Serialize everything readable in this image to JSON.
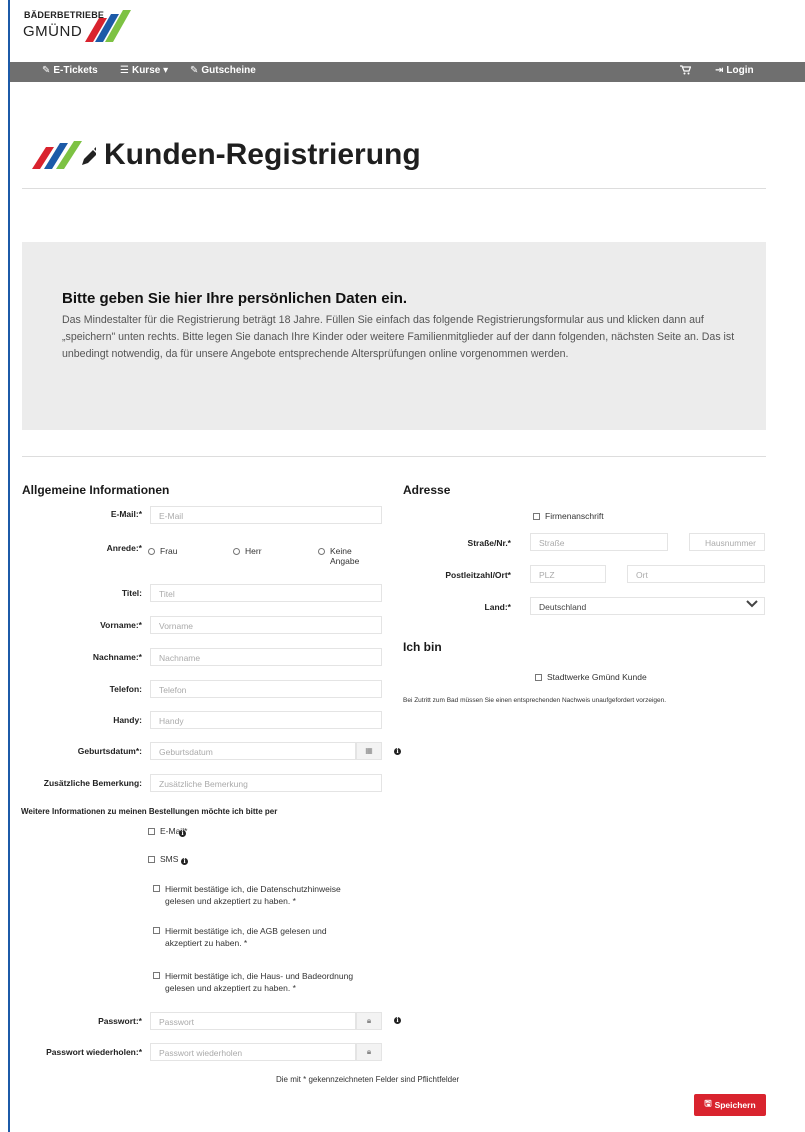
{
  "brand": {
    "line1": "BÄDERBETRIEBE",
    "line2": "GMÜND"
  },
  "colors": {
    "navbar": "#6f6f6f",
    "accent_red": "#d9232e",
    "brand_blue": "#1c5aa8",
    "brand_green": "#7dc243"
  },
  "nav": {
    "left": [
      {
        "icon": "ticket-icon",
        "label": "E-Tickets"
      },
      {
        "icon": "list-icon",
        "label": "Kurse ▾"
      },
      {
        "icon": "ticket-icon",
        "label": "Gutscheine"
      }
    ],
    "cart_icon": "cart-icon",
    "login": {
      "icon": "login-icon",
      "label": "Login"
    }
  },
  "page": {
    "title": "Kunden-Registrierung",
    "title_icon": "pencil-icon"
  },
  "intro": {
    "heading": "Bitte geben Sie hier Ihre persönlichen Daten ein.",
    "text": "Das Mindestalter für die Registrierung beträgt 18 Jahre. Füllen Sie einfach das folgende Registrierungsformular aus und klicken dann auf „speichern\" unten rechts. Bitte legen Sie danach Ihre Kinder oder weitere Familienmitglieder auf der dann folgenden, nächsten Seite an. Das ist unbedingt notwendig, da für unsere Angebote entsprechende Altersprüfungen online vorgenommen werden."
  },
  "general": {
    "heading": "Allgemeine Informationen",
    "email": {
      "label": "E-Mail:*",
      "placeholder": "E-Mail"
    },
    "salutation": {
      "label": "Anrede:*",
      "options": [
        "Frau",
        "Herr",
        "Keine Angabe"
      ]
    },
    "title": {
      "label": "Titel:",
      "placeholder": "Titel"
    },
    "firstname": {
      "label": "Vorname:*",
      "placeholder": "Vorname"
    },
    "lastname": {
      "label": "Nachname:*",
      "placeholder": "Nachname"
    },
    "phone": {
      "label": "Telefon:",
      "placeholder": "Telefon"
    },
    "mobile": {
      "label": "Handy:",
      "placeholder": "Handy"
    },
    "birthdate": {
      "label": "Geburtsdatum*:",
      "placeholder": "Geburtsdatum"
    },
    "remark": {
      "label": "Zusätzliche Bemerkung:",
      "placeholder": "Zusätzliche Bemerkung"
    },
    "contact_pref": "Weitere Informationen zu meinen Bestellungen möchte ich bitte per",
    "contact_email": "E-Mail*",
    "contact_sms": "SMS",
    "privacy": "Hiermit bestätige ich, die Datenschutzhinweise gelesen und akzeptiert zu haben. *",
    "agb": "Hiermit bestätige ich, die AGB gelesen und akzeptiert zu haben. *",
    "house_rules": "Hiermit bestätige ich, die Haus- und Badeordnung gelesen und akzeptiert zu haben. *",
    "password": {
      "label": "Passwort:*",
      "placeholder": "Passwort"
    },
    "password_repeat": {
      "label": "Passwort wiederholen:*",
      "placeholder": "Passwort wiederholen"
    },
    "required_note": "Die mit * gekennzeichneten Felder sind Pflichtfelder"
  },
  "address": {
    "heading": "Adresse",
    "company": "Firmenanschrift",
    "street": {
      "label": "Straße/Nr.*",
      "placeholder": "Straße",
      "number_placeholder": "Hausnummer"
    },
    "zip": {
      "label": "Postleitzahl/Ort*",
      "placeholder": "PLZ",
      "city_placeholder": "Ort"
    },
    "country": {
      "label": "Land:*",
      "value": "Deutschland"
    }
  },
  "ichbin": {
    "heading": "Ich bin",
    "customer": "Stadtwerke Gmünd Kunde",
    "note": "Bei Zutritt zum Bad müssen Sie einen entsprechenden Nachweis unaufgefordert vorzeigen."
  },
  "save": {
    "icon": "save-icon",
    "label": "Speichern"
  }
}
